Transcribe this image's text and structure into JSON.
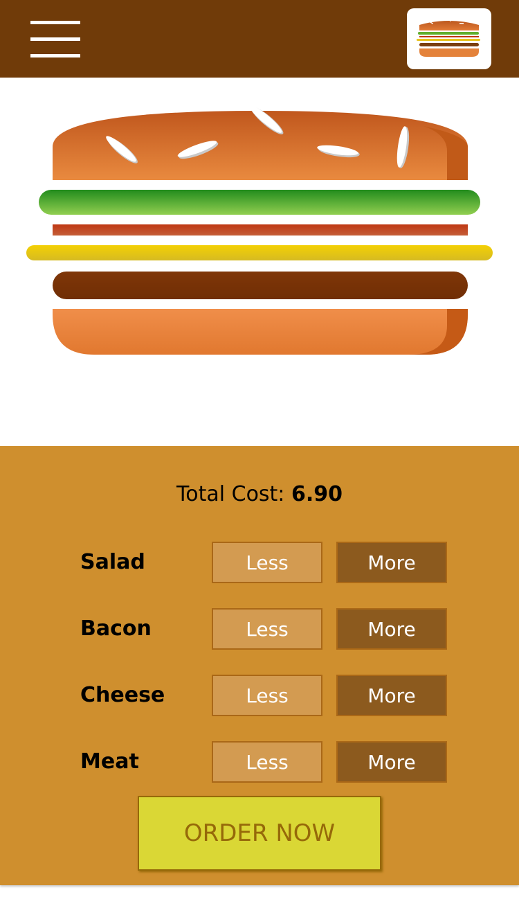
{
  "toolbar": {
    "menu_icon": "hamburger-menu-icon",
    "logo_icon": "burger-logo-icon",
    "background_color": "#703b09"
  },
  "burger": {
    "layers_top_to_bottom": [
      "bread-top",
      "salad",
      "bacon",
      "cheese",
      "meat",
      "bread-bottom"
    ]
  },
  "controls": {
    "total_label": "Total Cost: ",
    "total_value": "6.90",
    "rows": [
      {
        "label": "Salad",
        "less": "Less",
        "more": "More"
      },
      {
        "label": "Bacon",
        "less": "Less",
        "more": "More"
      },
      {
        "label": "Cheese",
        "less": "Less",
        "more": "More"
      },
      {
        "label": "Meat",
        "less": "Less",
        "more": "More"
      }
    ],
    "order_label": "ORDER NOW",
    "background_color": "#cf8f2e"
  }
}
